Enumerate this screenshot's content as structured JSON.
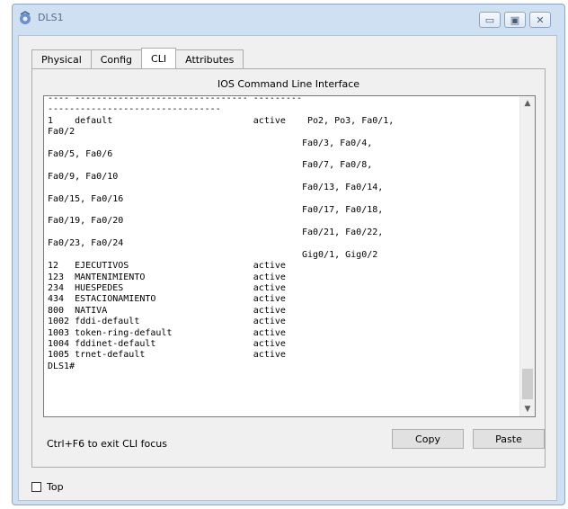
{
  "window": {
    "title": "DLS1",
    "minimize_icon": "minimize-icon",
    "maximize_icon": "maximize-icon",
    "close_icon": "close-icon",
    "minimize_glyph": "▭",
    "maximize_glyph": "▣",
    "close_glyph": "✕"
  },
  "tabs": [
    {
      "label": "Physical"
    },
    {
      "label": "Config"
    },
    {
      "label": "CLI",
      "active": true
    },
    {
      "label": "Attributes"
    }
  ],
  "cli": {
    "panel_title": "IOS Command Line Interface",
    "terminal_lines": [
      "---- -------------------------------- ---------",
      "--------------------------------",
      "1    default                          active    Po2, Po3, Fa0/1,",
      "Fa0/2",
      "                                               Fa0/3, Fa0/4,",
      "Fa0/5, Fa0/6",
      "                                               Fa0/7, Fa0/8,",
      "Fa0/9, Fa0/10",
      "                                               Fa0/13, Fa0/14,",
      "Fa0/15, Fa0/16",
      "                                               Fa0/17, Fa0/18,",
      "Fa0/19, Fa0/20",
      "                                               Fa0/21, Fa0/22,",
      "Fa0/23, Fa0/24",
      "                                               Gig0/1, Gig0/2",
      "12   EJECUTIVOS                       active",
      "123  MANTENIMIENTO                    active",
      "234  HUESPEDES                        active",
      "434  ESTACIONAMIENTO                  active",
      "800  NATIVA                           active",
      "1002 fddi-default                     active",
      "1003 token-ring-default               active",
      "1004 fddinet-default                  active",
      "1005 trnet-default                    active",
      "DLS1#"
    ],
    "hint": "Ctrl+F6 to exit CLI focus",
    "copy_label": "Copy",
    "paste_label": "Paste",
    "scroll_up_glyph": "▲",
    "scroll_down_glyph": "▼"
  },
  "footer": {
    "top_label": "Top",
    "top_checked": false
  },
  "colors": {
    "window_frame": "#cfe0f3",
    "content_bg": "#f0f0f0",
    "terminal_bg": "#ffffff"
  }
}
